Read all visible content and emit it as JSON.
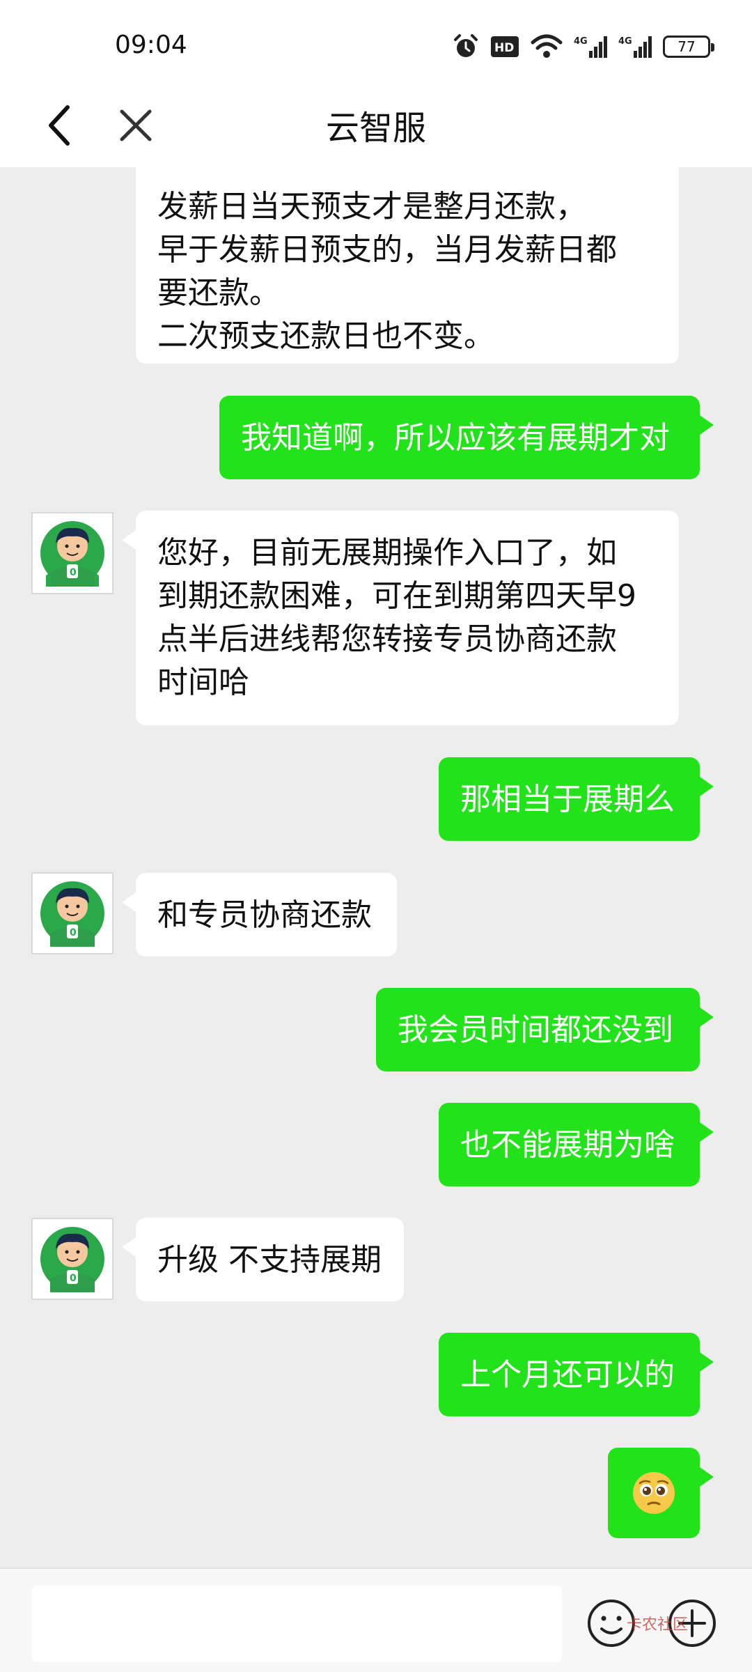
{
  "status_bar": {
    "time": "09:04",
    "battery": "77",
    "icons": [
      "alarm-icon",
      "hd-icon",
      "wifi-icon",
      "signal-4g-icon",
      "signal-4g-icon",
      "battery-icon"
    ]
  },
  "header": {
    "title": "云智服",
    "back_icon": "chevron-left-icon",
    "close_icon": "close-icon"
  },
  "messages": [
    {
      "side": "left",
      "avatar": false,
      "lines": [
        "发薪日当天预支才是整月还款，",
        "早于发薪日预支的，当月发薪日都",
        "要还款。",
        "二次预支还款日也不变。"
      ]
    },
    {
      "side": "right",
      "lines": [
        "我知道啊，所以应该有展期才对"
      ]
    },
    {
      "side": "left",
      "avatar": true,
      "lines": [
        "您好，目前无展期操作入口了，如",
        "到期还款困难，可在到期第四天早9",
        "点半后进线帮您转接专员协商还款",
        "时间哈"
      ]
    },
    {
      "side": "right",
      "lines": [
        "那相当于展期么"
      ]
    },
    {
      "side": "left",
      "avatar": true,
      "lines": [
        "和专员协商还款"
      ]
    },
    {
      "side": "right",
      "lines": [
        "我会员时间都还没到"
      ]
    },
    {
      "side": "right",
      "lines": [
        "也不能展期为啥"
      ]
    },
    {
      "side": "left",
      "avatar": true,
      "lines": [
        "升级 不支持展期"
      ]
    },
    {
      "side": "right",
      "lines": [
        "上个月还可以的"
      ]
    },
    {
      "side": "right",
      "emoji": "pleading-face-emoji"
    }
  ],
  "input_bar": {
    "input_value": "",
    "emoji_icon": "smiley-icon",
    "plus_icon": "plus-icon",
    "watermark": "卡农社区"
  },
  "colors": {
    "sent_bubble": "#22e31a",
    "received_bubble": "#ffffff",
    "background": "#ededed",
    "avatar_green": "#2aa84a"
  }
}
